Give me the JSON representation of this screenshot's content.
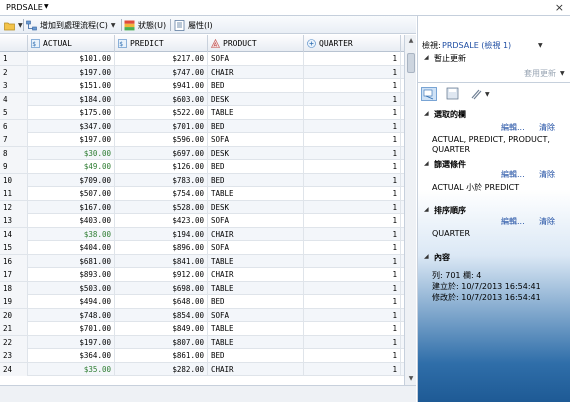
{
  "window": {
    "title": "PRDSALE"
  },
  "toolbar": {
    "add_to_flow_label": "增加到處理流程(C)",
    "status_label": "狀態(U)",
    "properties_label": "屬性(I)"
  },
  "grid": {
    "columns": [
      "ACTUAL",
      "PREDICT",
      "PRODUCT",
      "QUARTER"
    ],
    "rows": [
      {
        "n": "1",
        "actual": "$101.00",
        "predict": "$217.00",
        "product": "SOFA",
        "quarter": "1"
      },
      {
        "n": "2",
        "actual": "$197.00",
        "predict": "$747.00",
        "product": "CHAIR",
        "quarter": "1"
      },
      {
        "n": "3",
        "actual": "$151.00",
        "predict": "$941.00",
        "product": "BED",
        "quarter": "1"
      },
      {
        "n": "4",
        "actual": "$184.00",
        "predict": "$603.00",
        "product": "DESK",
        "quarter": "1"
      },
      {
        "n": "5",
        "actual": "$175.00",
        "predict": "$522.00",
        "product": "TABLE",
        "quarter": "1"
      },
      {
        "n": "6",
        "actual": "$347.00",
        "predict": "$701.00",
        "product": "BED",
        "quarter": "1"
      },
      {
        "n": "7",
        "actual": "$197.00",
        "predict": "$596.00",
        "product": "SOFA",
        "quarter": "1"
      },
      {
        "n": "8",
        "actual": "$30.00",
        "predict": "$697.00",
        "product": "DESK",
        "quarter": "1",
        "green": true
      },
      {
        "n": "9",
        "actual": "$49.00",
        "predict": "$126.00",
        "product": "BED",
        "quarter": "1",
        "green": true
      },
      {
        "n": "10",
        "actual": "$709.00",
        "predict": "$783.00",
        "product": "BED",
        "quarter": "1"
      },
      {
        "n": "11",
        "actual": "$507.00",
        "predict": "$754.00",
        "product": "TABLE",
        "quarter": "1"
      },
      {
        "n": "12",
        "actual": "$167.00",
        "predict": "$528.00",
        "product": "DESK",
        "quarter": "1"
      },
      {
        "n": "13",
        "actual": "$403.00",
        "predict": "$423.00",
        "product": "SOFA",
        "quarter": "1"
      },
      {
        "n": "14",
        "actual": "$38.00",
        "predict": "$194.00",
        "product": "CHAIR",
        "quarter": "1",
        "green": true
      },
      {
        "n": "15",
        "actual": "$404.00",
        "predict": "$896.00",
        "product": "SOFA",
        "quarter": "1"
      },
      {
        "n": "16",
        "actual": "$681.00",
        "predict": "$841.00",
        "product": "TABLE",
        "quarter": "1"
      },
      {
        "n": "17",
        "actual": "$893.00",
        "predict": "$912.00",
        "product": "CHAIR",
        "quarter": "1"
      },
      {
        "n": "18",
        "actual": "$503.00",
        "predict": "$698.00",
        "product": "TABLE",
        "quarter": "1"
      },
      {
        "n": "19",
        "actual": "$494.00",
        "predict": "$648.00",
        "product": "BED",
        "quarter": "1"
      },
      {
        "n": "20",
        "actual": "$748.00",
        "predict": "$854.00",
        "product": "SOFA",
        "quarter": "1"
      },
      {
        "n": "21",
        "actual": "$701.00",
        "predict": "$849.00",
        "product": "TABLE",
        "quarter": "1"
      },
      {
        "n": "22",
        "actual": "$197.00",
        "predict": "$807.00",
        "product": "TABLE",
        "quarter": "1"
      },
      {
        "n": "23",
        "actual": "$364.00",
        "predict": "$861.00",
        "product": "BED",
        "quarter": "1"
      },
      {
        "n": "24",
        "actual": "$35.00",
        "predict": "$282.00",
        "product": "CHAIR",
        "quarter": "1",
        "green": true
      }
    ]
  },
  "panel": {
    "view_label": "檢視:",
    "view_value": "PRDSALE (檢視 1)",
    "stop_update": "暫止更新",
    "apply_update": "套用更新",
    "selected_columns": "選取的欄",
    "edit": "編輯...",
    "clear": "清除",
    "selected_columns_value": "ACTUAL, PREDICT, PRODUCT, QUARTER",
    "filter_condition": "篩選條件",
    "filter_value": "ACTUAL 小於 PREDICT",
    "sort_order": "排序順序",
    "sort_value": "QUARTER",
    "content": "內容",
    "columns_count": "列: 701  欄: 4",
    "created": "建立於: 10/7/2013 16:54:41",
    "modified": "修改於: 10/7/2013 16:54:41"
  }
}
